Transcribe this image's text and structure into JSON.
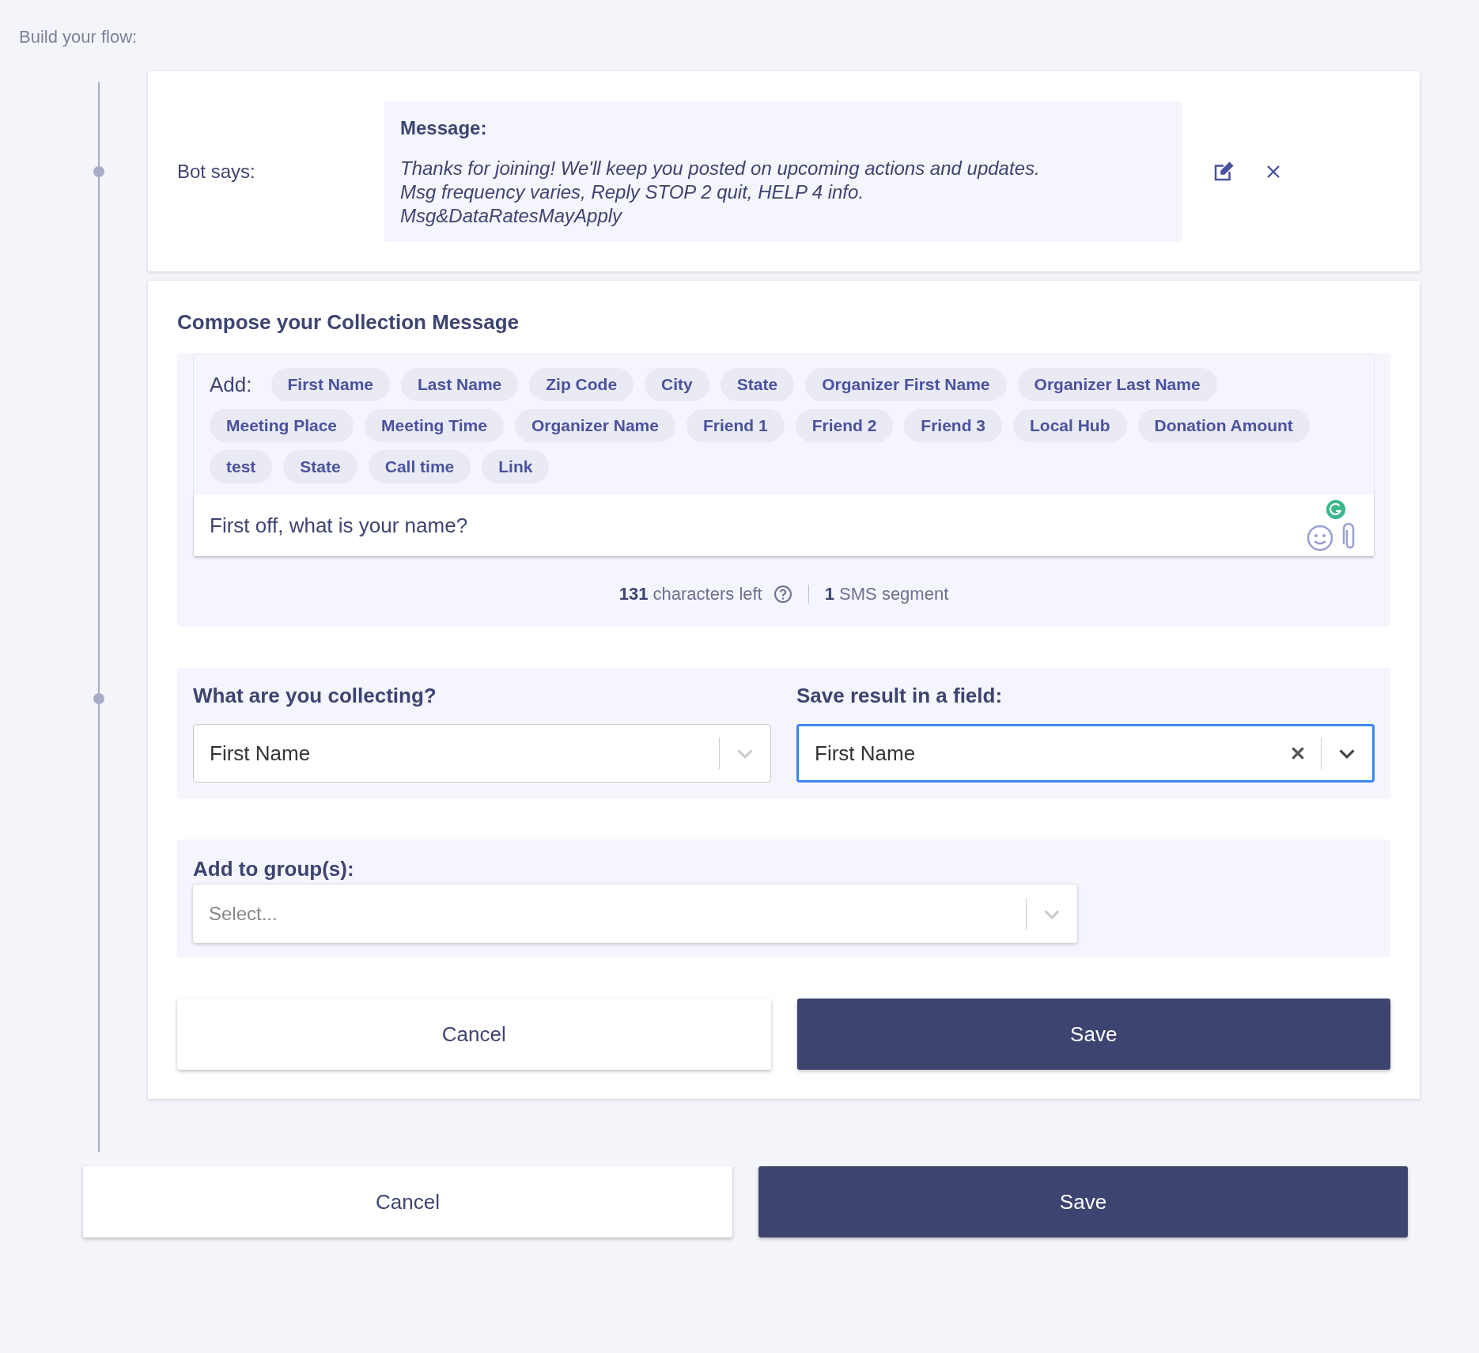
{
  "heading": "Build your flow:",
  "steps": [
    {
      "label": "Bot says:",
      "message_title": "Message:",
      "message_lines": [
        "Thanks for joining! We'll keep you posted on upcoming actions and updates.",
        "Msg frequency varies, Reply STOP 2 quit, HELP 4 info.",
        "Msg&DataRatesMayApply"
      ]
    }
  ],
  "composer": {
    "title": "Compose your Collection Message",
    "add_label": "Add:",
    "tags": [
      "First Name",
      "Last Name",
      "Zip Code",
      "City",
      "State",
      "Organizer First Name",
      "Organizer Last Name",
      "Meeting Place",
      "Meeting Time",
      "Organizer Name",
      "Friend 1",
      "Friend 2",
      "Friend 3",
      "Local Hub",
      "Donation Amount",
      "test",
      "State",
      "Call time",
      "Link"
    ],
    "value": "First off, what is your name?",
    "chars_left": "131",
    "chars_label": "characters left",
    "segments": "1",
    "segments_label": "SMS segment"
  },
  "collect": [
    {
      "label": "What are you collecting?",
      "value": "First Name",
      "focused": false
    },
    {
      "label": "Save result in a field:",
      "value": "First Name",
      "focused": true
    }
  ],
  "group": {
    "label": "Add to group(s):",
    "placeholder": "Select..."
  },
  "card_buttons": [
    {
      "label": "Cancel",
      "kind": "secondary"
    },
    {
      "label": "Save",
      "kind": "primary"
    }
  ],
  "page_buttons": [
    {
      "label": "Cancel",
      "kind": "secondary"
    },
    {
      "label": "Save",
      "kind": "primary"
    }
  ]
}
